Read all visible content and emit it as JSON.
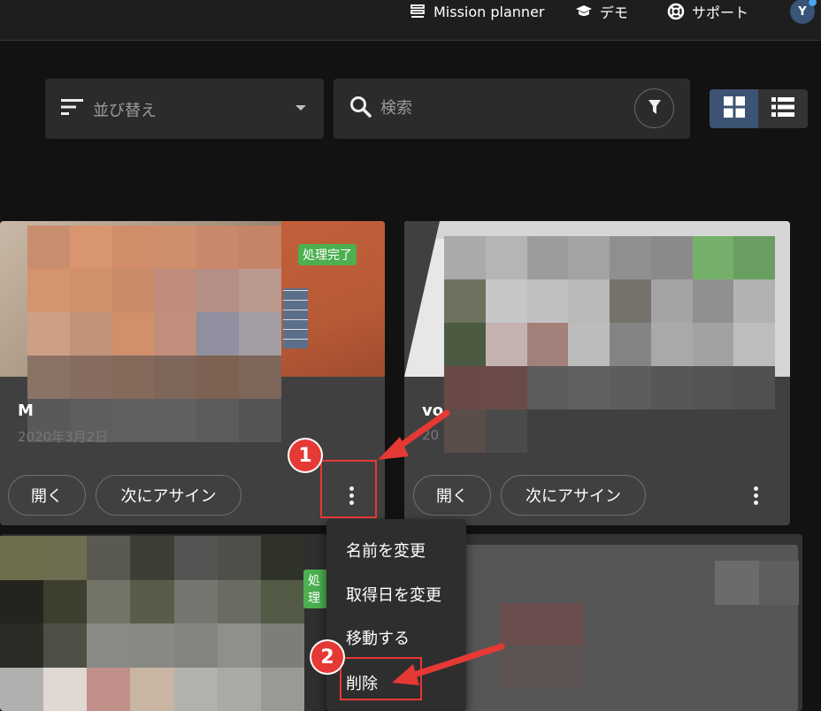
{
  "topbar": {
    "mission_planner": "Mission planner",
    "demo": "デモ",
    "support": "サポート",
    "avatar_initial": "Y"
  },
  "toolbar": {
    "sort_label": "並び替え",
    "search_placeholder": "検索"
  },
  "cards": [
    {
      "title": "M",
      "date": "2020年3月2日",
      "status_badge": "処理完了",
      "open_label": "開く",
      "assign_label": "次にアサイン"
    },
    {
      "title": "vo",
      "date": "20",
      "open_label": "開く",
      "assign_label": "次にアサイン"
    },
    {
      "status_badge": "処理"
    }
  ],
  "context_menu": {
    "items": [
      "名前を変更",
      "取得日を変更",
      "移動する",
      "削除"
    ]
  },
  "annotations": {
    "step1": "1",
    "step2": "2",
    "accent_color": "#e53935"
  },
  "colors": {
    "background": "#121212",
    "card": "#404040",
    "badge_green": "#4caf50",
    "toggle_active": "#3d5373"
  }
}
